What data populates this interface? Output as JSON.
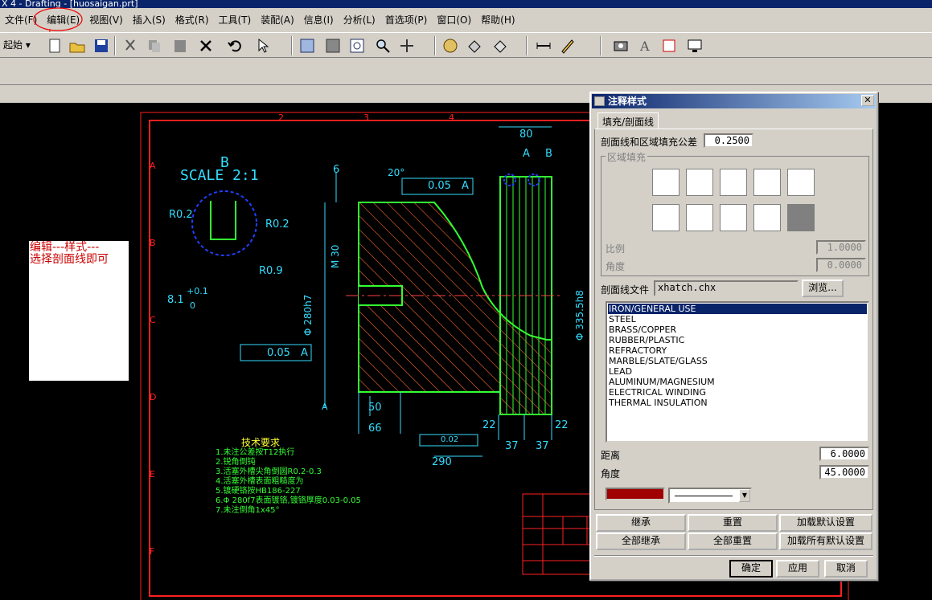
{
  "window": {
    "title": "X 4 - Drafting - [huosaigan.prt]"
  },
  "menubar": [
    "文件(F)",
    "编辑(E)",
    "视图(V)",
    "插入(S)",
    "格式(R)",
    "工具(T)",
    "装配(A)",
    "信息(I)",
    "分析(L)",
    "首选项(P)",
    "窗口(O)",
    "帮助(H)"
  ],
  "toolbar": {
    "start_label": "起始"
  },
  "annotation_note": {
    "line1": "编辑---样式---",
    "line2": "选择剖面线即可"
  },
  "drawing": {
    "detail_label": "B",
    "scale_label": "SCALE 2:1",
    "dims": [
      "80",
      "6",
      "0.05",
      "A",
      "R0.2",
      "R0.2",
      "R0.9",
      "8.1",
      "+0.1",
      "0",
      "M 30",
      "Φ 280h7",
      "-0.056",
      "-0.106",
      "Φ 335.5h8",
      "0",
      "-0.14",
      "Φ 359",
      "Φ 359",
      "50",
      "66",
      "22",
      "22",
      "37",
      "37",
      "0.02",
      "A",
      "290",
      "0",
      "-0.3",
      "0.05",
      "A",
      "A",
      "A",
      "B",
      "20°"
    ],
    "border_letters": [
      "A",
      "B",
      "C",
      "D",
      "E",
      "F"
    ],
    "border_numbers": [
      "2",
      "3",
      "4"
    ],
    "tech_title": "技术要求",
    "tech_lines": [
      "1.未注公差按T12执行",
      "2.锐角倒钝",
      "3.活塞外槽尖角倒圆R0.2-0.3",
      "4.活塞外槽表面粗糙度为",
      "5.镀硬铬按HB186-227",
      "6.Φ 280f7表面镀铬,镀铬厚度0.03-0.05",
      "7.未注倒角1x45°"
    ]
  },
  "dialog": {
    "title": "注释样式",
    "tab": "填充/剖面线",
    "tolerance_label": "剖面线和区域填充公差",
    "tolerance_value": "0.2500",
    "fill_group": "区域填充",
    "scale_label": "比例",
    "scale_value": "1.0000",
    "angle_label": "角度",
    "angle_value": "0.0000",
    "file_label": "剖面线文件",
    "file_value": "xhatch.chx",
    "browse": "浏览...",
    "hatch_types": [
      "IRON/GENERAL USE",
      "STEEL",
      "BRASS/COPPER",
      "RUBBER/PLASTIC",
      "REFRACTORY",
      "MARBLE/SLATE/GLASS",
      "LEAD",
      "ALUMINUM/MAGNESIUM",
      "ELECTRICAL WINDING",
      "THERMAL INSULATION"
    ],
    "distance_label": "距离",
    "distance_value": "6.0000",
    "hatch_angle_label": "角度",
    "hatch_angle_value": "45.0000",
    "color": "#a00000",
    "buttons": {
      "inherit": "继承",
      "reset": "重置",
      "load_default": "加载默认设置",
      "inherit_all": "全部继承",
      "reset_all": "全部重置",
      "load_all_default": "加载所有默认设置"
    },
    "ok": "确定",
    "apply": "应用",
    "cancel": "取消"
  },
  "colors": {
    "hatch_line": "#ff6a30",
    "geometry": "#33ff33",
    "dimension": "#33ddff",
    "border": "#ff2020",
    "note": "#ffff33"
  }
}
